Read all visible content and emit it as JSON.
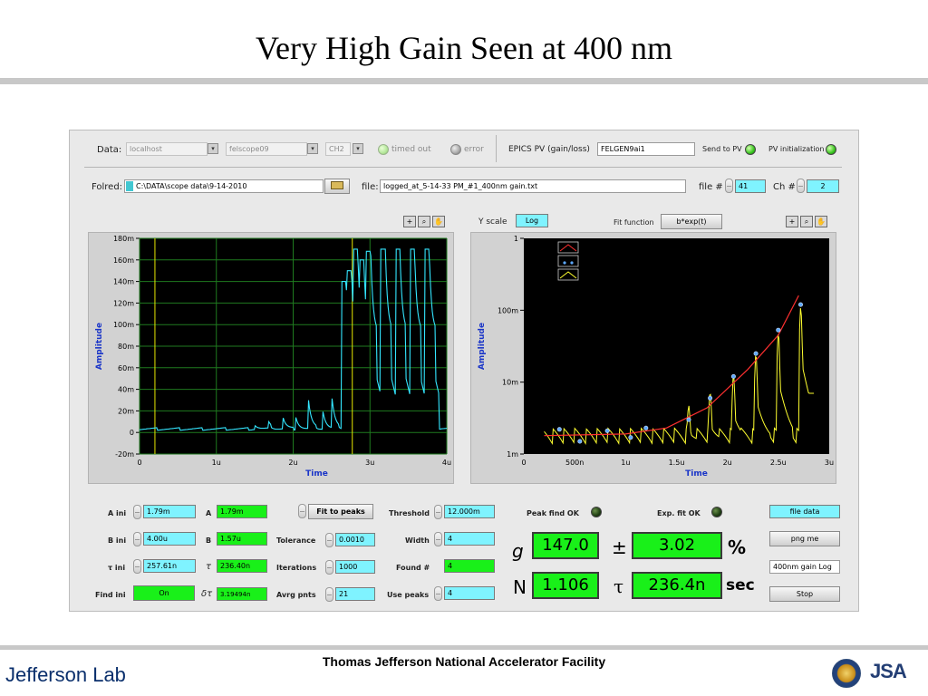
{
  "slide": {
    "title": "Very High Gain Seen at 400 nm",
    "footer": "Thomas Jefferson National Accelerator Facility",
    "logo_left": "Jefferson Lab",
    "logo_right": "JSA"
  },
  "top": {
    "data_label": "Data:",
    "data_host": "localhost",
    "data_scope": "felscope09",
    "data_channel": "CH2",
    "timed_out": "timed out",
    "error": "error",
    "epics_label": "EPICS PV (gain/loss)",
    "epics_value": "FELGEN9ai1",
    "send_to_pv": "Send to PV",
    "pv_init": "PV initialization",
    "folder_label": "Folred:",
    "folder_value": "C:\\DATA\\scope data\\9-14-2010",
    "file_label": "file:",
    "file_value": "logged_at_5-14-33 PM_#1_400nm gain.txt",
    "file_num_label": "file #",
    "file_num_value": "41",
    "ch_label": "Ch #",
    "ch_value": "2"
  },
  "left_plot": {
    "y_title": "Amplitude",
    "x_title": "Time",
    "y_ticks": [
      "180m",
      "160m",
      "140m",
      "120m",
      "100m",
      "80m",
      "60m",
      "40m",
      "20m",
      "0",
      "-20m"
    ],
    "x_ticks": [
      "0",
      "1u",
      "2u",
      "3u",
      "4u"
    ]
  },
  "right_plot": {
    "yscale_label": "Y scale",
    "yscale_value": "Log",
    "fit_label": "Fit function",
    "fit_value": "b*exp(t)",
    "y_title": "Amplitude",
    "x_title": "Time",
    "y_ticks": [
      "1",
      "100m",
      "10m",
      "1m"
    ],
    "x_ticks": [
      "0",
      "500n",
      "1u",
      "1.5u",
      "2u",
      "2.5u",
      "3u"
    ],
    "legend": [
      "fit",
      "peaks",
      "data"
    ]
  },
  "chart_data": [
    {
      "type": "line",
      "xlabel": "Time",
      "ylabel": "Amplitude",
      "xlim": [
        0,
        4e-06
      ],
      "ylim": [
        -0.02,
        0.18
      ],
      "series": [
        {
          "color": "#33e6ff",
          "x": [
            0,
            1.5e-06,
            1.85e-06,
            2.2e-06,
            2.5e-06,
            2.6e-06,
            2.65e-06,
            2.7e-06,
            2.75e-06,
            2.8e-06,
            2.85e-06,
            3e-06,
            3.1e-06,
            3.2e-06,
            3.3e-06,
            3.4e-06,
            3.5e-06,
            3.6e-06,
            3.7e-06,
            3.8e-06,
            3.9e-06
          ],
          "y": [
            0.002,
            0.003,
            0.014,
            0.026,
            0.032,
            0.1,
            0.142,
            0.152,
            0.17,
            0.16,
            0.168,
            0.17,
            0.17,
            0.17,
            0.17,
            0.17,
            0.17,
            0.17,
            0.17,
            0.17,
            0.17
          ]
        }
      ]
    },
    {
      "type": "line",
      "xlabel": "Time",
      "ylabel": "Amplitude",
      "xlim": [
        0,
        3e-06
      ],
      "ylim": [
        0.001,
        1
      ],
      "yscale": "log",
      "series": [
        {
          "name": "fit",
          "color": "#ff3030",
          "x": [
            2e-07,
            1e-06,
            1.4e-06,
            1.8e-06,
            2.2e-06,
            2.5e-06,
            2.7e-06
          ],
          "y": [
            0.0018,
            0.0019,
            0.0023,
            0.0044,
            0.015,
            0.045,
            0.16
          ]
        },
        {
          "name": "peaks",
          "color": "#5da8ff",
          "x": [
            3.5e-07,
            5.5e-07,
            8.2e-07,
            1.05e-06,
            1.2e-06,
            1.62e-06,
            1.83e-06,
            2.06e-06,
            2.28e-06,
            2.5e-06,
            2.72e-06
          ],
          "y": [
            0.0022,
            0.0015,
            0.0021,
            0.0017,
            0.0023,
            0.003,
            0.006,
            0.012,
            0.025,
            0.053,
            0.12
          ]
        },
        {
          "name": "data",
          "color": "#ffff30",
          "x": [
            2e-07,
            5e-07,
            1e-06,
            1.45e-06,
            1.6e-06,
            1.83e-06,
            2.06e-06,
            2.28e-06,
            2.5e-06,
            2.72e-06,
            2.85e-06
          ],
          "y": [
            0.0016,
            0.0017,
            0.0016,
            0.0019,
            0.0027,
            0.0055,
            0.012,
            0.026,
            0.053,
            0.12,
            0.007
          ]
        }
      ]
    }
  ],
  "controls": {
    "a_ini_label": "A ini",
    "a_ini_value": "1.79m",
    "a_label": "A",
    "a_value": "1.79m",
    "b_ini_label": "B ini",
    "b_ini_value": "4.00u",
    "b_label": "B",
    "b_value": "1.57u",
    "tau_ini_label": "τ ini",
    "tau_ini_value": "257.61n",
    "tau_label": "τ",
    "tau_value": "236.40n",
    "find_ini_label": "Find ini",
    "find_ini_value": "On",
    "dtau_label": "δτ",
    "dtau_value": "3.19494n",
    "fit_to_peaks": "Fit to peaks",
    "tolerance_label": "Tolerance",
    "tolerance_value": "0.0010",
    "iterations_label": "Iterations",
    "iterations_value": "1000",
    "avrg_label": "Avrg pnts",
    "avrg_value": "21",
    "threshold_label": "Threshold",
    "threshold_value": "12.000m",
    "width_label": "Width",
    "width_value": "4",
    "found_label": "Found #",
    "found_value": "4",
    "use_peaks_label": "Use peaks",
    "use_peaks_value": "4"
  },
  "results": {
    "peak_find_ok": "Peak find OK",
    "exp_fit_ok": "Exp. fit OK",
    "g_label": "g",
    "g_value": "147.0",
    "pm": "±",
    "g_err": "3.02",
    "pct": "%",
    "n_label": "N",
    "n_value": "1.106",
    "tau_label": "τ",
    "tau_value": "236.4n",
    "sec": "sec",
    "file_data": "file data",
    "png_me": "png me",
    "gain_log": "400nm gain Log",
    "stop": "Stop"
  }
}
